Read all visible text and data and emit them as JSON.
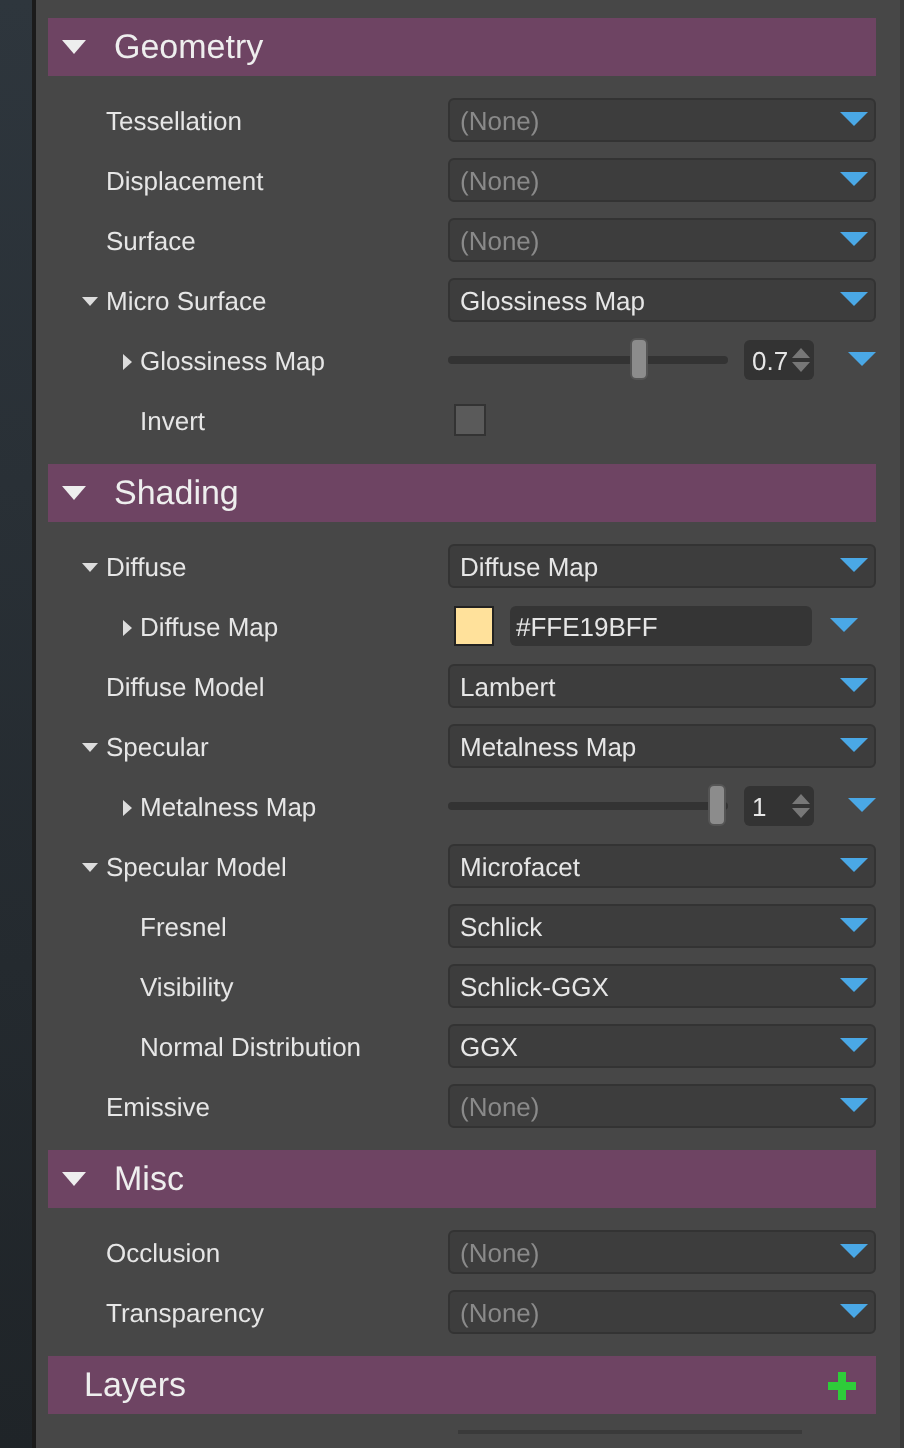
{
  "sections": [
    {
      "title": "Geometry",
      "expanded": true,
      "rows": [
        {
          "label": "Tessellation",
          "kind": "dropdown",
          "value": "(None)",
          "disabled": true
        },
        {
          "label": "Displacement",
          "kind": "dropdown",
          "value": "(None)",
          "disabled": true
        },
        {
          "label": "Surface",
          "kind": "dropdown",
          "value": "(None)",
          "disabled": true
        },
        {
          "label": "Micro Surface",
          "kind": "dropdown",
          "value": "Glossiness Map",
          "disabled": false,
          "expanded": true,
          "children": [
            {
              "label": "Glossiness Map",
              "kind": "slider",
              "level": 0.7,
              "reading": "0.7",
              "expanded": false
            },
            {
              "label": "Invert",
              "kind": "checkbox",
              "checked": false
            }
          ]
        }
      ]
    },
    {
      "title": "Shading",
      "expanded": true,
      "rows": [
        {
          "label": "Diffuse",
          "kind": "dropdown",
          "value": "Diffuse Map",
          "disabled": false,
          "expanded": true,
          "children": [
            {
              "label": "Diffuse Map",
              "kind": "color",
              "color": "#ffe19b",
              "value": "#FFE19BFF",
              "expanded": false
            }
          ]
        },
        {
          "label": "Diffuse Model",
          "kind": "dropdown",
          "value": "Lambert",
          "disabled": false
        },
        {
          "label": "Specular",
          "kind": "dropdown",
          "value": "Metalness Map",
          "disabled": false,
          "expanded": true,
          "children": [
            {
              "label": "Metalness Map",
              "kind": "slider",
              "level": 1,
              "reading": "1",
              "expanded": false
            }
          ]
        },
        {
          "label": "Specular Model",
          "kind": "dropdown",
          "value": "Microfacet",
          "disabled": false,
          "expanded": true,
          "children": [
            {
              "label": "Fresnel",
              "kind": "dropdown",
              "value": "Schlick",
              "disabled": false
            },
            {
              "label": "Visibility",
              "kind": "dropdown",
              "value": "Schlick-GGX",
              "disabled": false
            },
            {
              "label": "Normal Distribution",
              "kind": "dropdown",
              "value": "GGX",
              "disabled": false
            }
          ]
        },
        {
          "label": "Emissive",
          "kind": "dropdown",
          "value": "(None)",
          "disabled": true
        }
      ]
    },
    {
      "title": "Misc",
      "expanded": true,
      "rows": [
        {
          "label": "Occlusion",
          "kind": "dropdown",
          "value": "(None)",
          "disabled": true
        },
        {
          "label": "Transparency",
          "kind": "dropdown",
          "value": "(None)",
          "disabled": true
        }
      ]
    },
    {
      "title": "Layers",
      "add_button": true
    }
  ]
}
